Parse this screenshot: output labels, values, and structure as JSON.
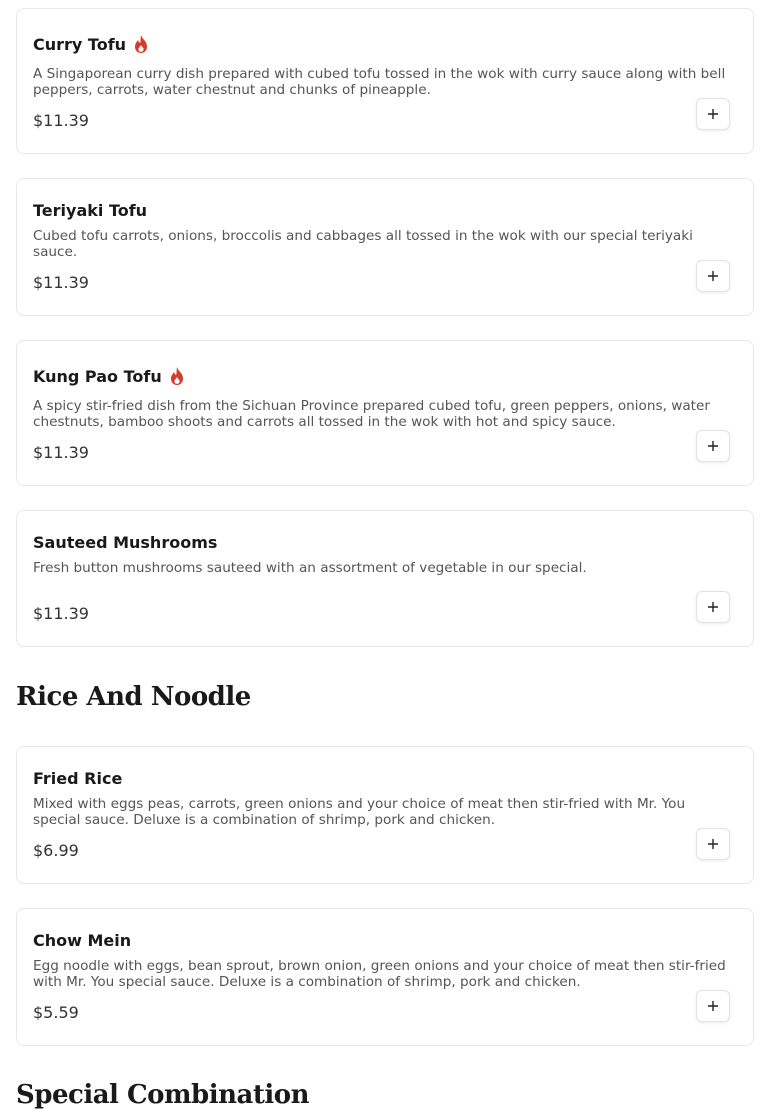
{
  "items": [
    {
      "name": "Curry Tofu",
      "spicy": true,
      "description": "A Singaporean curry dish prepared with cubed tofu tossed in the wok with curry sauce along with bell peppers, carrots, water chestnut and chunks of pineapple.",
      "price": "$11.39",
      "add_icon": "plus-icon"
    },
    {
      "name": "Teriyaki Tofu",
      "spicy": false,
      "description": "Cubed tofu carrots, onions, broccolis and cabbages all tossed in the wok with our special teriyaki sauce.",
      "price": "$11.39",
      "add_icon": "plus-icon"
    },
    {
      "name": "Kung Pao Tofu",
      "spicy": true,
      "description": "A spicy stir-fried dish from the Sichuan Province prepared cubed tofu, green peppers, onions, water chestnuts, bamboo shoots and carrots all tossed in the wok with hot and spicy sauce.",
      "price": "$11.39",
      "add_icon": "plus-icon"
    },
    {
      "name": "Sauteed Mushrooms",
      "spicy": false,
      "description": "Fresh button mushrooms sauteed with an assortment of vegetable in our special.",
      "price": "$11.39",
      "add_icon": "plus-icon"
    },
    {
      "name": "Fried Rice",
      "spicy": false,
      "description": "Mixed with eggs peas, carrots, green onions and your choice of meat then stir-fried with Mr. You special sauce. Deluxe is a combination of shrimp, pork and chicken.",
      "price": "$6.99",
      "add_icon": "plus-icon"
    },
    {
      "name": "Chow Mein",
      "spicy": false,
      "description": "Egg noodle with eggs, bean sprout, brown onion, green onions and your choice of meat then stir-fried with Mr. You special sauce. Deluxe is a combination of shrimp, pork and chicken.",
      "price": "$5.59",
      "add_icon": "plus-icon"
    }
  ],
  "sections": {
    "rice_and_noodle": "Rice And Noodle",
    "special_combination": "Special Combination"
  },
  "colors": {
    "spicy_icon": "#d63a2a",
    "card_border": "#e8e8e8",
    "description_text": "#555555"
  }
}
